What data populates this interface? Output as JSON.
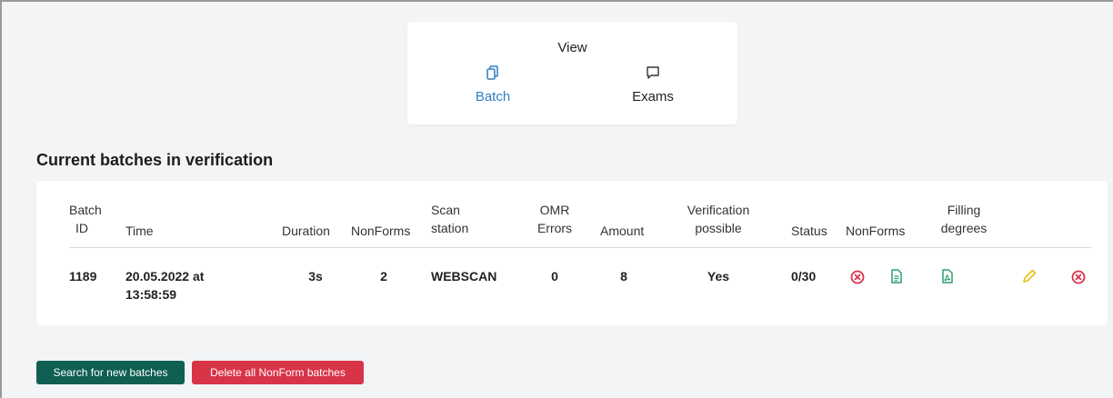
{
  "view": {
    "title": "View",
    "options": [
      {
        "label": "Batch",
        "icon": "copy-icon",
        "active": true
      },
      {
        "label": "Exams",
        "icon": "comment-icon",
        "active": false
      }
    ]
  },
  "section_title": "Current batches in verification",
  "table": {
    "headers": {
      "batch_id": [
        "Batch",
        "ID"
      ],
      "time": "Time",
      "duration": "Duration",
      "nonforms": "NonForms",
      "scan_station": [
        "Scan",
        "station"
      ],
      "omr_errors": [
        "OMR",
        "Errors"
      ],
      "amount": "Amount",
      "verification": [
        "Verification",
        "possible"
      ],
      "status": "Status",
      "nonforms_actions": "NonForms",
      "filling": [
        "Filling",
        "degrees"
      ]
    },
    "rows": [
      {
        "batch_id": "1189",
        "time": [
          "20.05.2022 at",
          "13:58:59"
        ],
        "duration": "3s",
        "nonforms": "2",
        "scan_station": "WEBSCAN",
        "omr_errors": "0",
        "amount": "8",
        "verification": "Yes",
        "status": "0/30"
      }
    ]
  },
  "buttons": {
    "search": "Search for new batches",
    "delete": "Delete all NonForm batches"
  },
  "colors": {
    "accent_blue": "#2f7fc1",
    "danger": "#d83448",
    "success_green": "#2e9e6d",
    "edit_yellow": "#e0c21a",
    "primary_dark_green": "#0f5f53"
  }
}
